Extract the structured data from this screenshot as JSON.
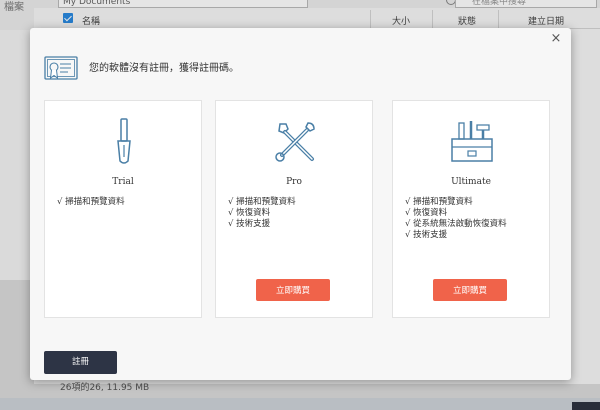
{
  "background": {
    "left_label": "檔案",
    "path_value": "My Documents",
    "search_placeholder": "在檔案中搜尋",
    "columns": {
      "name": "名稱",
      "size": "大小",
      "status": "狀態",
      "created": "建立日期"
    },
    "status_bar": "26項的26, 11.95 MB"
  },
  "dialog": {
    "notice": "您的軟體沒有註冊，獲得註冊碼。",
    "close_symbol": "×",
    "register_label": "註冊",
    "plans": [
      {
        "name": "Trial",
        "icon": "screwdriver-icon",
        "features": [
          "√ 掃描和預覽資料"
        ]
      },
      {
        "name": "Pro",
        "icon": "wrench-screwdriver-icon",
        "features": [
          "√ 掃描和預覽資料",
          "√ 恢復資料",
          "√ 技術支援"
        ],
        "buy_label": "立即購買"
      },
      {
        "name": "Ultimate",
        "icon": "toolbox-icon",
        "features": [
          "√ 掃描和預覽資料",
          "√ 恢復資料",
          "√ 從系統無法啟動恢復資料",
          "√ 技術支援"
        ],
        "buy_label": "立即購買"
      }
    ]
  },
  "colors": {
    "accent_orange": "#f0634a",
    "dark_button": "#2d3445",
    "icon_blue": "#4a7fa6",
    "checkbox_blue": "#2a8ae0"
  }
}
